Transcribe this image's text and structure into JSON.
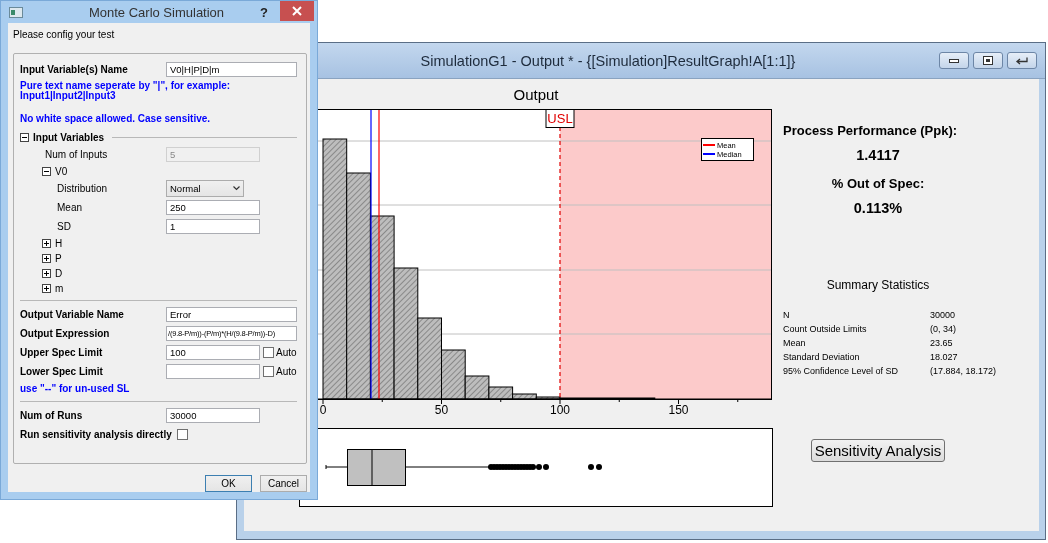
{
  "dialog": {
    "title": "Monte Carlo Simulation",
    "help": "?",
    "prompt": "Please config your test",
    "input_name": {
      "label": "Input Variable(s) Name",
      "value": "V0|H|P|D|m"
    },
    "input_hint": [
      "Pure text name seperate by \"|\", for example:",
      "Input1|Input2|Input3"
    ],
    "input_note": "No white space allowed. Case sensitive.",
    "input_variables": {
      "label": "Input Variables",
      "expanded": true,
      "num_of_inputs": {
        "label": "Num of Inputs",
        "value": "5",
        "disabled": true
      },
      "children": [
        {
          "name": "V0",
          "expanded": true,
          "params": [
            {
              "kind": "select",
              "label": "Distribution",
              "value": "Normal"
            },
            {
              "kind": "text",
              "label": "Mean",
              "value": "250"
            },
            {
              "kind": "text",
              "label": "SD",
              "value": "1"
            }
          ]
        },
        {
          "name": "H",
          "expanded": false
        },
        {
          "name": "P",
          "expanded": false
        },
        {
          "name": "D",
          "expanded": false
        },
        {
          "name": "m",
          "expanded": false
        }
      ]
    },
    "output_name": {
      "label": "Output Variable Name",
      "value": "Error"
    },
    "output_expression": {
      "label": "Output Expression",
      "value": "/(9.8-P/m))-(P/m)*(H/(9.8-P/m))-D)"
    },
    "spec_limits": [
      {
        "label": "Upper Spec Limit",
        "value": "100",
        "auto_label": "Auto",
        "auto": false
      },
      {
        "label": "Lower Spec Limit",
        "auto_label": "Auto",
        "auto": false
      }
    ],
    "spec_note": "use \"--\" for un-used SL",
    "num_runs": {
      "label": "Num of Runs",
      "value": "30000"
    },
    "sensitivity": {
      "label": "Run sensitivity analysis directly",
      "checked": false
    },
    "buttons": [
      {
        "label": "OK",
        "default": true
      },
      {
        "label": "Cancel",
        "default": false
      }
    ]
  },
  "graph_window": {
    "title": "SimulationG1 - Output * - {[Simulation]ResultGraph!A[1:1]}",
    "chart": {
      "title": "Output",
      "x_tick_labels": [
        "0",
        "50",
        "100",
        "150"
      ],
      "spec_label": "USL",
      "legend": [
        {
          "label": "Mean",
          "color": "#ff0000"
        },
        {
          "label": "Median",
          "color": "#0000ff"
        }
      ]
    },
    "ppk": {
      "label": "Process Performance (Ppk):",
      "value": "1.4117"
    },
    "out_of_spec": {
      "label": "% Out of Spec:",
      "value": "0.113%"
    },
    "summary": {
      "title": "Summary Statistics",
      "rows": [
        {
          "label": "N",
          "value": "30000"
        },
        {
          "label": "Count Outside Limits",
          "value": "(0, 34)"
        },
        {
          "label": "Mean",
          "value": "23.65"
        },
        {
          "label": "Standard Deviation",
          "value": "18.027"
        },
        {
          "label": "95% Confidence Level of SD",
          "value": "(17.884, 18.172)"
        }
      ]
    },
    "action_button": "Sensitivity Analysis"
  }
}
